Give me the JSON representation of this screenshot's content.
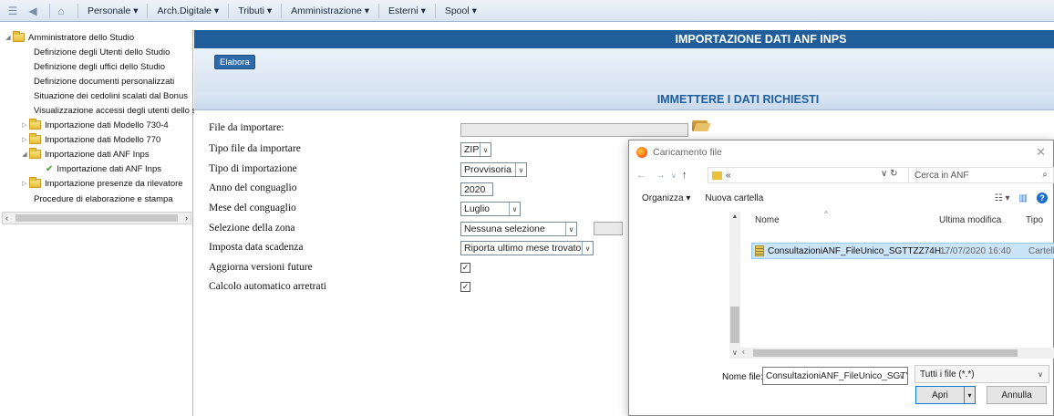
{
  "menubar": {
    "items": [
      "Personale ▾",
      "Arch.Digitale ▾",
      "Tributi ▾",
      "Amministrazione ▾",
      "Esterni ▾",
      "Spool ▾"
    ]
  },
  "tree": {
    "items": [
      {
        "label": "Administratore dello Studio",
        "text": "Amministratore dello Studio"
      },
      {
        "text": "Definizione degli Utenti dello Studio"
      },
      {
        "text": "Definizione degli uffici dello Studio"
      },
      {
        "text": "Definizione documenti personalizzati"
      },
      {
        "text": "Situazione dei cedolini scalati dal Bonus"
      },
      {
        "text": "Visualizzazione accessi degli utenti dello studi"
      },
      {
        "text": "Importazione dati Modello 730-4"
      },
      {
        "text": "Importazione dati Modello 770"
      },
      {
        "text": "Importazione dati ANF Inps"
      },
      {
        "text": "Importazione dati ANF Inps"
      },
      {
        "text": "Importazione presenze da rilevatore"
      },
      {
        "text": "Procedure di elaborazione e stampa"
      }
    ]
  },
  "main": {
    "title": "IMPORTAZIONE DATI ANF INPS",
    "elabora_label": "Elabora",
    "section_title": "IMMETTERE I DATI RICHIESTI",
    "fields": {
      "file_label": "File da importare:",
      "tipo_file_label": "Tipo file da importare",
      "tipo_file_value": "ZIP",
      "tipo_import_label": "Tipo di importazione",
      "tipo_import_value": "Provvisoria",
      "anno_label": "Anno del conguaglio",
      "anno_value": "2020",
      "mese_label": "Mese del conguaglio",
      "mese_value": "Luglio",
      "zona_label": "Selezione della zona",
      "zona_value": "Nessuna selezione",
      "scadenza_label": "Imposta data scadenza",
      "scadenza_value": "Riporta ultimo mese trovato",
      "aggiorna_label": "Aggiorna versioni future",
      "aggiorna_checked": true,
      "calcolo_label": "Calcolo automatico arretrati",
      "calcolo_checked": true
    }
  },
  "dialog": {
    "title": "Caricamento file",
    "path": "«",
    "search_placeholder": "Cerca in ANF",
    "organizza": "Organizza ▾",
    "nuova_cartella": "Nuova cartella",
    "columns": {
      "name": "Nome",
      "modified": "Ultima modifica",
      "type": "Tipo"
    },
    "files": [
      {
        "name": "ConsultazioniANF_FileUnico_SGTTZZ74H...",
        "modified": "17/07/2020 16:40",
        "type": "Cartella"
      }
    ],
    "filename_label": "Nome file:",
    "filename_value": "ConsultazioniANF_FileUnico_SGT'",
    "filetype_value": "Tutti i file (*.*)",
    "open_label": "Apri",
    "cancel_label": "Annulla"
  }
}
